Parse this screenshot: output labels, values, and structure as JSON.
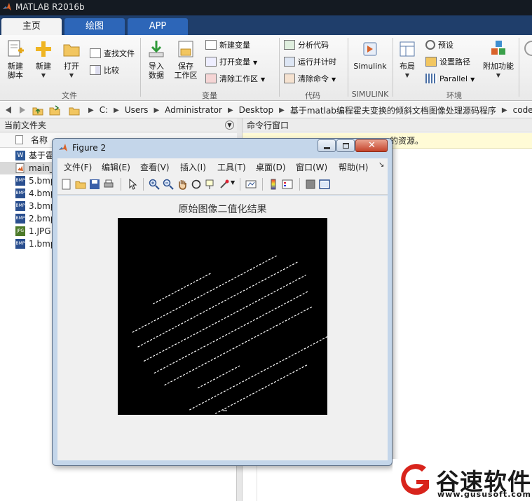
{
  "window": {
    "title": "MATLAB R2016b"
  },
  "tabs": [
    {
      "label": "主页",
      "active": true
    },
    {
      "label": "绘图",
      "active": false
    },
    {
      "label": "APP",
      "active": false
    }
  ],
  "ribbon": {
    "file": {
      "group_label": "文件",
      "new_script": "新建\n脚本",
      "new": "新建",
      "open": "打开",
      "find_files": "查找文件",
      "compare": "比较"
    },
    "variable": {
      "group_label": "变量",
      "import_data": "导入\n数据",
      "save_workspace": "保存\n工作区",
      "new_variable": "新建变量",
      "open_variable": "打开变量",
      "clear_workspace": "清除工作区"
    },
    "code": {
      "group_label": "代码",
      "analyze_code": "分析代码",
      "run_and_time": "运行并计时",
      "clear_commands": "清除命令"
    },
    "simulink": {
      "group_label": "SIMULINK",
      "simulink": "Simulink"
    },
    "environment": {
      "group_label": "环境",
      "layout": "布局",
      "preferences": "预设",
      "set_path": "设置路径",
      "parallel": "Parallel",
      "addons": "附加功能"
    }
  },
  "address": {
    "crumbs": [
      "C:",
      "Users",
      "Administrator",
      "Desktop",
      "基于matlab编程霍夫变换的倾斜文档图像处理源码程序",
      "code"
    ]
  },
  "current_folder": {
    "title": "当前文件夹",
    "column_name": "名称",
    "files": [
      {
        "name": "基于霍",
        "type": "doc",
        "selected": false
      },
      {
        "name": "main_",
        "type": "m",
        "selected": true
      },
      {
        "name": "5.bmp",
        "type": "bmp",
        "selected": false
      },
      {
        "name": "4.bmp",
        "type": "bmp",
        "selected": false
      },
      {
        "name": "3.bmp",
        "type": "bmp",
        "selected": false
      },
      {
        "name": "2.bmp",
        "type": "bmp",
        "selected": false
      },
      {
        "name": "1.JPG",
        "type": "jpg",
        "selected": false
      },
      {
        "name": "1.bmp",
        "type": "bmp",
        "selected": false
      }
    ]
  },
  "command_window": {
    "title": "命令行窗口",
    "notice": "的资源。"
  },
  "figure": {
    "title": "Figure 2",
    "menus": [
      "文件(F)",
      "编辑(E)",
      "查看(V)",
      "插入(I)",
      "工具(T)",
      "桌面(D)",
      "窗口(W)",
      "帮助(H)"
    ],
    "plot_title": "原始图像二值化结果"
  },
  "watermark": {
    "name": "谷速软件",
    "url": "www.gususoft.com"
  },
  "colors": {
    "tab_bar": "#1f3e6b",
    "tab_inactive": "#2d66b8",
    "title_bar": "#141a22",
    "watermark_red": "#d8241c"
  }
}
